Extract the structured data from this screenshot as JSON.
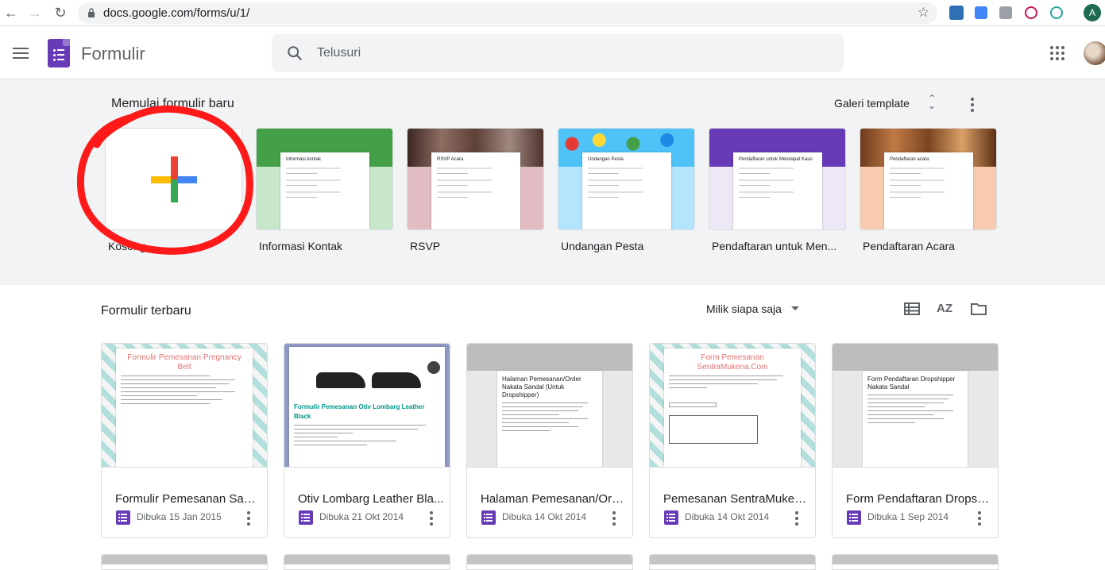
{
  "browser": {
    "url": "docs.google.com/forms/u/1/",
    "profile_initial": "A"
  },
  "header": {
    "app_title": "Formulir",
    "search_placeholder": "Telusuri"
  },
  "templates": {
    "section_title": "Memulai formulir baru",
    "gallery_label": "Galeri template",
    "items": [
      {
        "label": "Kosong",
        "header_color": "#ffffff"
      },
      {
        "label": "Informasi Kontak",
        "header_color": "#43a047",
        "paper_title": "Informasi kontak"
      },
      {
        "label": "RSVP",
        "header_color": "#5d4037",
        "paper_title": "RSVP Acara"
      },
      {
        "label": "Undangan Pesta",
        "header_color": "#4fc3f7",
        "paper_title": "Undangan Pesta"
      },
      {
        "label": "Pendaftaran untuk Men...",
        "header_color": "#673ab7",
        "paper_title": "Pendaftaran untuk Mendapat Kaus"
      },
      {
        "label": "Pendaftaran Acara",
        "header_color": "#8d4e2b",
        "paper_title": "Pendaftaran acara"
      }
    ]
  },
  "recent": {
    "section_title": "Formulir terbaru",
    "owner_filter": "Milik siapa saja",
    "sort_label": "AZ",
    "forms": [
      {
        "name": "Formulir Pemesanan Sabu...",
        "opened": "Dibuka 15 Jan 2015",
        "thumb_title": "Formulir Pemesanan Pregnancy Belt"
      },
      {
        "name": "Otiv Lombarg Leather Bla...",
        "opened": "Dibuka 21 Okt 2014",
        "thumb_title": "Formulir Pemesanan Otiv Lombarg Leather Black"
      },
      {
        "name": "Halaman Pemesanan/Ord...",
        "opened": "Dibuka 14 Okt 2014",
        "thumb_title": "Halaman Pemesanan/Order Nakata Sandal (Untuk Dropshipper)"
      },
      {
        "name": "Pemesanan SentraMuken...",
        "opened": "Dibuka 14 Okt 2014",
        "thumb_title": "Form Pemesanan SentraMukena.Com"
      },
      {
        "name": "Form Pendaftaran Dropsh...",
        "opened": "Dibuka 1 Sep 2014",
        "thumb_title": "Form Pendaftaran Dropshipper Nakata Sandal"
      }
    ]
  },
  "colors": {
    "accent": "#673ab7",
    "annotation": "#ff1a1a"
  }
}
